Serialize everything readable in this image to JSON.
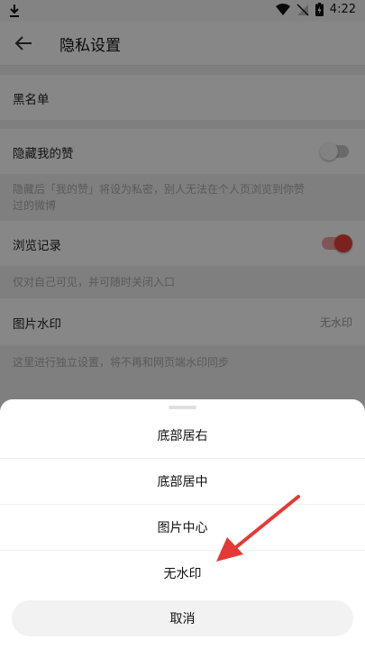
{
  "status_bar": {
    "time": "4:22"
  },
  "header": {
    "title": "隐私设置"
  },
  "settings": {
    "blacklist_label": "黑名单",
    "hide_likes_label": "隐藏我的赞",
    "hide_likes_desc_line1": "隐藏后「我的赞」将设为私密，别人无法在个人页浏览到你赞",
    "hide_likes_desc_line2": "过的微博",
    "hide_likes_enabled": false,
    "history_label": "浏览记录",
    "history_desc": "仅对自己可见，并可随时关闭入口",
    "history_enabled": true,
    "watermark_label": "图片水印",
    "watermark_value": "无水印",
    "watermark_desc": "这里进行独立设置，将不再和网页端水印同步"
  },
  "sheet": {
    "options": [
      "底部居右",
      "底部居中",
      "图片中心",
      "无水印"
    ],
    "cancel_label": "取消"
  },
  "colors": {
    "accent": "#e8413b",
    "annotation_arrow": "#e53935"
  }
}
